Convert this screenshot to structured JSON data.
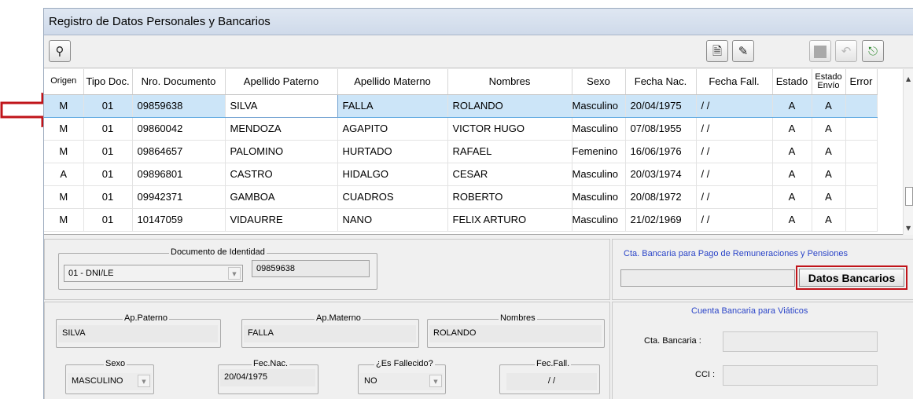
{
  "window": {
    "title": "Registro de Datos Personales y Bancarios"
  },
  "toolbar": {
    "search": "search-binoculars-icon",
    "new": "new-document-icon",
    "edit": "edit-form-icon",
    "stop": "stop-icon",
    "undo": "undo-icon",
    "exit": "exit-door-icon"
  },
  "grid": {
    "headers": [
      "Origen",
      "Tipo Doc.",
      "Nro. Documento",
      "Apellido Paterno",
      "Apellido Materno",
      "Nombres",
      "Sexo",
      "Fecha Nac.",
      "Fecha Fall.",
      "Estado",
      "Estado Envío",
      "Error"
    ],
    "rows": [
      {
        "origen": "M",
        "tipo": "01",
        "nro": "09859638",
        "paterno": "SILVA",
        "materno": "FALLA",
        "nombres": "ROLANDO",
        "sexo": "Masculino",
        "fnac": "20/04/1975",
        "ffall": "/ /",
        "estado": "A",
        "envio": "A",
        "error": ""
      },
      {
        "origen": "M",
        "tipo": "01",
        "nro": "09860042",
        "paterno": "MENDOZA",
        "materno": "AGAPITO",
        "nombres": "VICTOR HUGO",
        "sexo": "Masculino",
        "fnac": "07/08/1955",
        "ffall": "/ /",
        "estado": "A",
        "envio": "A",
        "error": ""
      },
      {
        "origen": "M",
        "tipo": "01",
        "nro": "09864657",
        "paterno": "PALOMINO",
        "materno": "HURTADO",
        "nombres": "RAFAEL",
        "sexo": "Femenino",
        "fnac": "16/06/1976",
        "ffall": "/ /",
        "estado": "A",
        "envio": "A",
        "error": ""
      },
      {
        "origen": "A",
        "tipo": "01",
        "nro": "09896801",
        "paterno": "CASTRO",
        "materno": "HIDALGO",
        "nombres": "CESAR",
        "sexo": "Masculino",
        "fnac": "20/03/1974",
        "ffall": "/ /",
        "estado": "A",
        "envio": "A",
        "error": ""
      },
      {
        "origen": "M",
        "tipo": "01",
        "nro": "09942371",
        "paterno": "GAMBOA",
        "materno": "CUADROS",
        "nombres": "ROBERTO",
        "sexo": "Masculino",
        "fnac": "20/08/1972",
        "ffall": "/ /",
        "estado": "A",
        "envio": "A",
        "error": ""
      },
      {
        "origen": "M",
        "tipo": "01",
        "nro": "10147059",
        "paterno": "VIDAURRE",
        "materno": "NANO",
        "nombres": "FELIX ARTURO",
        "sexo": "Masculino",
        "fnac": "21/02/1969",
        "ffall": "/ /",
        "estado": "A",
        "envio": "A",
        "error": ""
      }
    ]
  },
  "documento": {
    "label": "Documento de Identidad",
    "tipo": "01  -  DNI/LE",
    "numero": "09859638"
  },
  "cta_remuneraciones": {
    "label": "Cta. Bancaria para Pago de Remuneraciones y Pensiones",
    "value": "",
    "button": "Datos Bancarios"
  },
  "nombres": {
    "paterno_label": "Ap.Paterno",
    "paterno": "SILVA",
    "materno_label": "Ap.Materno",
    "materno": "FALLA",
    "nombres_label": "Nombres",
    "nombres": "ROLANDO"
  },
  "detalles": {
    "sexo_label": "Sexo",
    "sexo": "MASCULINO",
    "fecnac_label": "Fec.Nac.",
    "fecnac": "20/04/1975",
    "fallecido_label": "¿Es Fallecido?",
    "fallecido": "NO",
    "fecfall_label": "Fec.Fall.",
    "fecfall": "/ /"
  },
  "viaticos": {
    "label": "Cuenta Bancaria para Viáticos",
    "cta_label": "Cta. Bancaria :",
    "cta": "",
    "cci_label": "CCI :",
    "cci": ""
  },
  "colors": {
    "selection": "#cce5f8",
    "highlight_box": "#c0141a",
    "blue_text": "#2b45c8"
  }
}
